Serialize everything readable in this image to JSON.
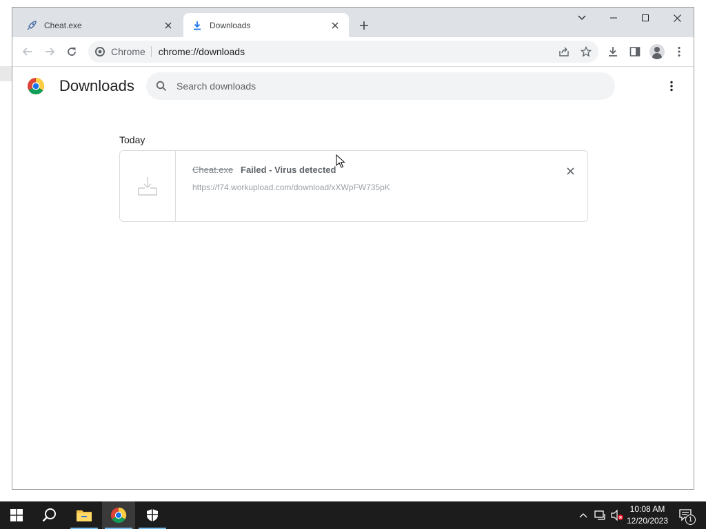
{
  "browser": {
    "tabs": [
      {
        "title": "Cheat.exe",
        "active": false,
        "favicon": "rocket-icon"
      },
      {
        "title": "Downloads",
        "active": true,
        "favicon": "download-arrow-icon"
      }
    ],
    "omnibox": {
      "chip_label": "Chrome",
      "url_path": "chrome://downloads"
    }
  },
  "downloads_page": {
    "title": "Downloads",
    "search_placeholder": "Search downloads",
    "section_date": "Today",
    "items": [
      {
        "file_name": "Cheat.exe",
        "status": "Failed - Virus detected",
        "url": "https://f74.workupload.com/download/xXWpFW735pK"
      }
    ]
  },
  "taskbar": {
    "time": "10:08 AM",
    "date": "12/20/2023",
    "notification_count": "1"
  },
  "colors": {
    "tabstrip_bg": "#dee1e6",
    "omnibox_bg": "#f1f3f4",
    "taskbar_bg": "#1c1c1c",
    "accent_blue": "#1a73e8"
  }
}
